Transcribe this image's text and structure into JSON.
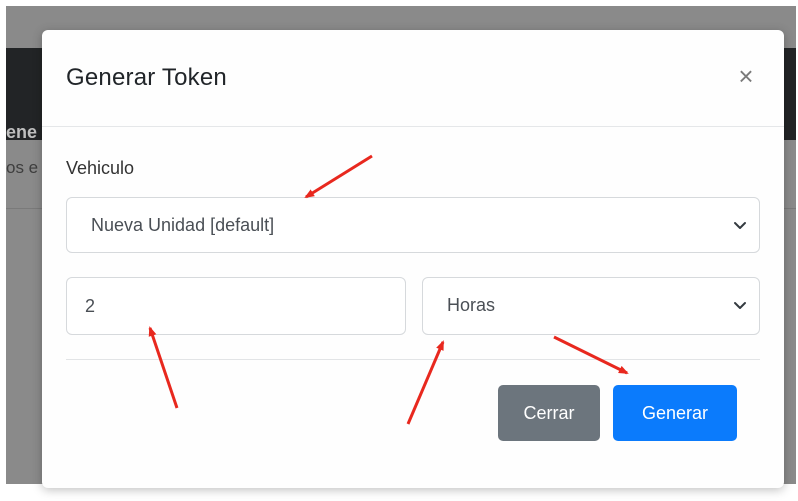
{
  "background": {
    "navbar_text": "ene",
    "sub_text": "os e"
  },
  "modal": {
    "title": "Generar Token",
    "close_label": "×",
    "vehicle_label": "Vehiculo",
    "vehicle_selected": "Nueva Unidad [default]",
    "quantity_value": "2",
    "unit_selected": "Horas",
    "cancel_label": "Cerrar",
    "submit_label": "Generar"
  },
  "colors": {
    "primary": "#0b7bfc",
    "secondary": "#6c757d",
    "annotation_arrow": "#e8281e"
  },
  "icons": {
    "close": "close-icon",
    "vehicle_dropdown": "chevron-down-icon",
    "unit_dropdown": "chevron-down-icon"
  }
}
